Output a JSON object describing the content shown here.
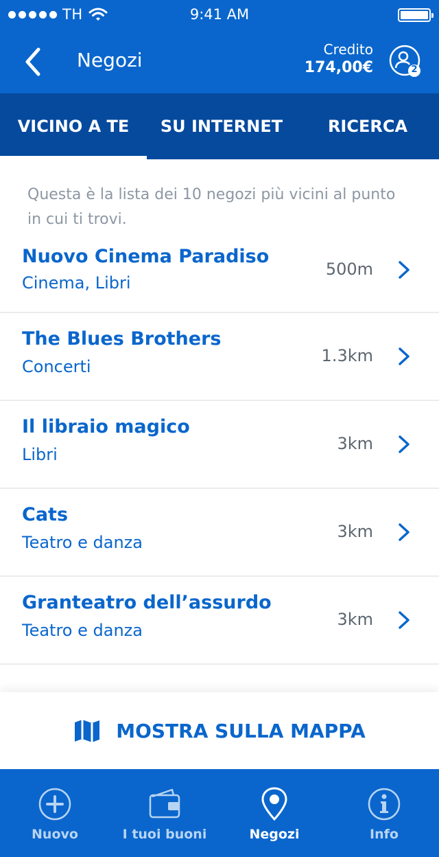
{
  "status_bar": {
    "carrier": "TH",
    "time": "9:41 AM"
  },
  "header": {
    "title": "Negozi",
    "credit_label": "Credito",
    "credit_value": "174,00€",
    "profile_badge": "2"
  },
  "tabs": [
    {
      "label": "VICINO A TE",
      "active": true
    },
    {
      "label": "SU INTERNET",
      "active": false
    },
    {
      "label": "RICERCA",
      "active": false
    }
  ],
  "intro_text": "Questa è la lista dei 10 negozi più vicini al punto in cui ti trovi.",
  "shops": [
    {
      "name": "Nuovo Cinema Paradiso",
      "category": "Cinema, Libri",
      "distance": "500m"
    },
    {
      "name": "The Blues Brothers",
      "category": "Concerti",
      "distance": "1.3km"
    },
    {
      "name": "Il libraio magico",
      "category": "Libri",
      "distance": "3km"
    },
    {
      "name": "Cats",
      "category": "Teatro e danza",
      "distance": "3km"
    },
    {
      "name": "Granteatro dell’assurdo",
      "category": "Teatro e danza",
      "distance": "3km"
    }
  ],
  "map_button": {
    "label": "MOSTRA SULLA MAPPA",
    "icon": "map-icon"
  },
  "tab_bar": [
    {
      "label": "Nuovo",
      "icon": "plus-circle-icon",
      "active": false
    },
    {
      "label": "I tuoi buoni",
      "icon": "wallet-icon",
      "active": false
    },
    {
      "label": "Negozi",
      "icon": "location-pin-icon",
      "active": true
    },
    {
      "label": "Info",
      "icon": "info-icon",
      "active": false
    }
  ],
  "colors": {
    "primary": "#0a66cc",
    "tab_bg": "#064a9e",
    "muted_text": "#8c97a3",
    "distance_text": "#5c6670",
    "inactive_tab_label": "#b8d4f3"
  }
}
